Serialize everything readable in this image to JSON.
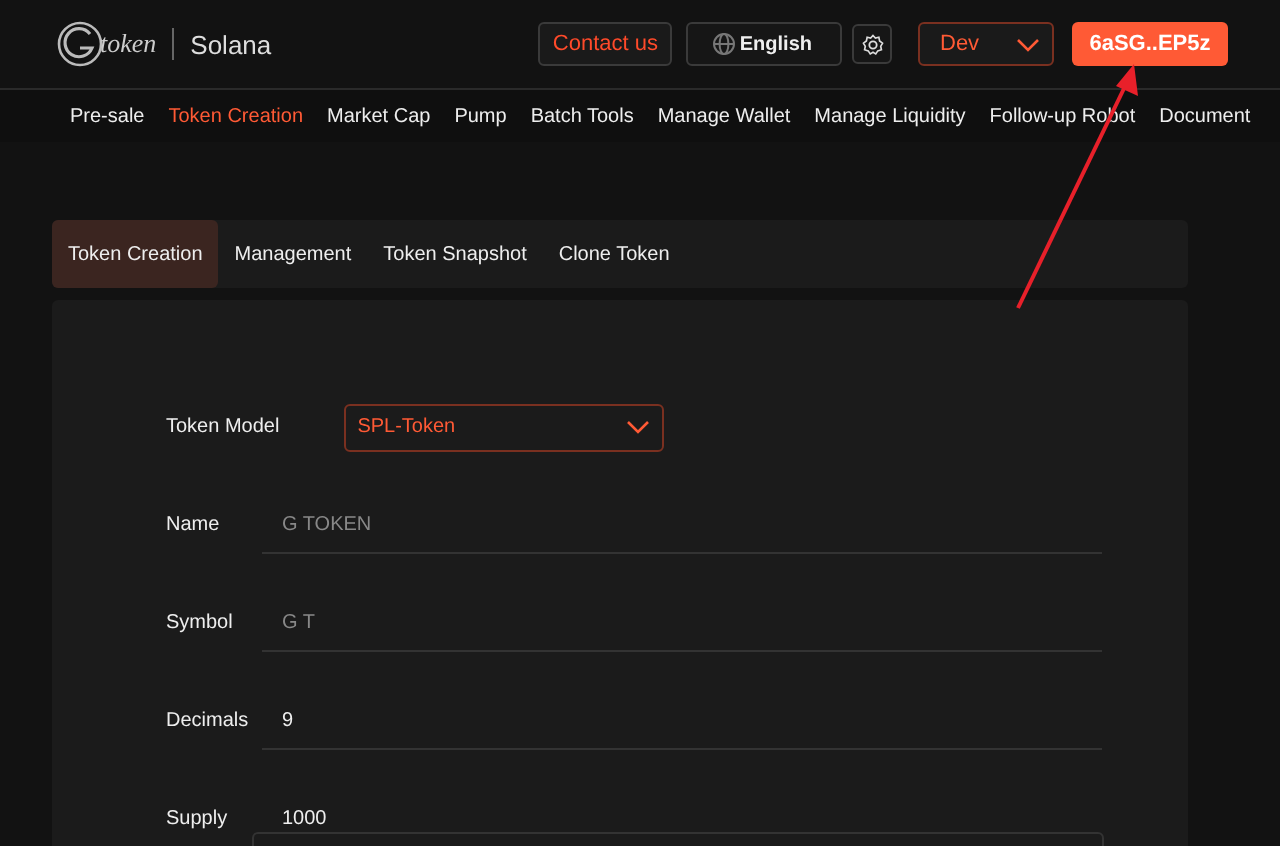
{
  "header": {
    "logo_text": "token",
    "network": "Solana",
    "contact": "Contact us",
    "language": "English",
    "env": "Dev",
    "wallet": "6aSG..EP5z"
  },
  "nav": [
    {
      "label": "Pre-sale",
      "selected": false
    },
    {
      "label": "Token Creation",
      "selected": true
    },
    {
      "label": "Market Cap",
      "selected": false
    },
    {
      "label": "Pump",
      "selected": false
    },
    {
      "label": "Batch Tools",
      "selected": false
    },
    {
      "label": "Manage Wallet",
      "selected": false
    },
    {
      "label": "Manage Liquidity",
      "selected": false
    },
    {
      "label": "Follow-up Robot",
      "selected": false
    },
    {
      "label": "Document",
      "selected": false
    }
  ],
  "tabs": [
    {
      "label": "Token Creation",
      "selected": true
    },
    {
      "label": "Management",
      "selected": false
    },
    {
      "label": "Token Snapshot",
      "selected": false
    },
    {
      "label": "Clone Token",
      "selected": false
    }
  ],
  "form": [
    {
      "kind": "select",
      "label": "Token Model",
      "value": "SPL-Token"
    },
    {
      "kind": "text",
      "label": "Name",
      "placeholder": "G TOKEN"
    },
    {
      "kind": "text",
      "label": "Symbol",
      "placeholder": "G T"
    },
    {
      "kind": "text",
      "label": "Decimals",
      "value": "9"
    },
    {
      "kind": "text",
      "label": "Supply",
      "value": "1000"
    }
  ]
}
